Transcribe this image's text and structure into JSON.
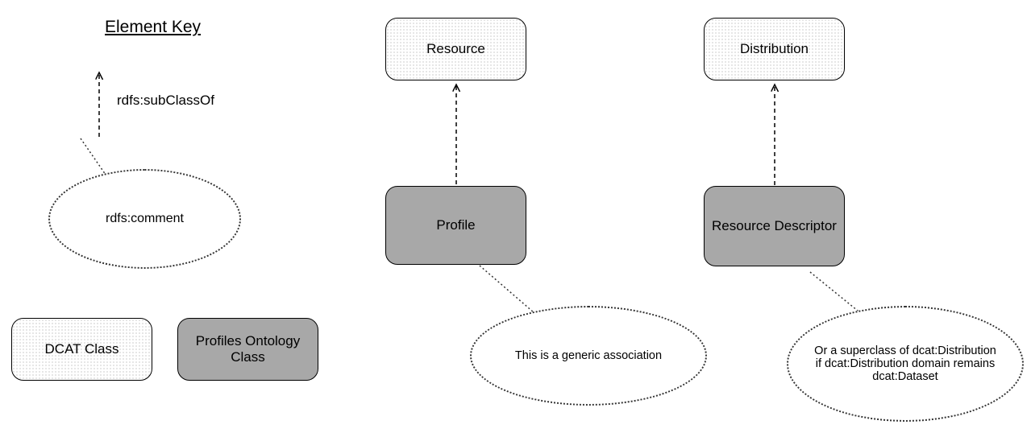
{
  "title": "Element Key",
  "subclass_label": "rdfs:subClassOf",
  "comment_label": "rdfs:comment",
  "key": {
    "dcat_class": "DCAT Class",
    "profiles_class": "Profiles Ontology Class"
  },
  "left": {
    "resource": "Resource",
    "profile": "Profile",
    "comment": "This is a generic association"
  },
  "right": {
    "distribution": "Distribution",
    "resource_descriptor": "Resource Descriptor",
    "comment": "Or a superclass of dcat:Distribution if dcat:Distribution domain remains dcat:Dataset"
  }
}
